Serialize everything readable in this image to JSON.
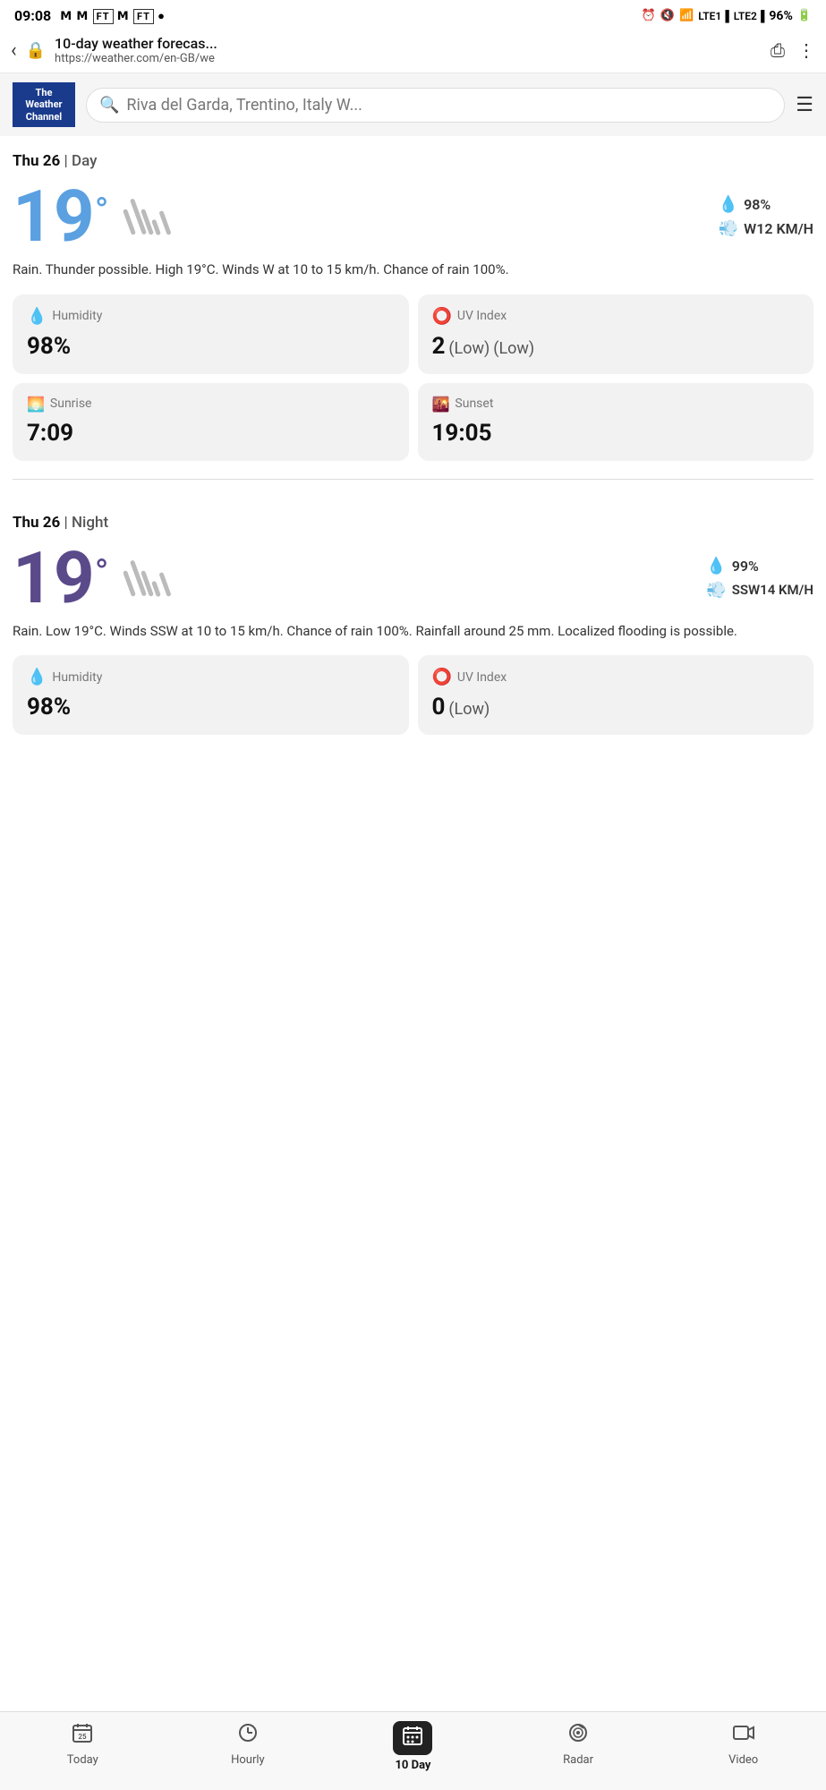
{
  "statusBar": {
    "time": "09:08",
    "leftIcons": "M M FT M FT •",
    "battery": "96%"
  },
  "browserBar": {
    "title": "10-day weather forecas...",
    "url": "https://weather.com/en-GB/we"
  },
  "header": {
    "logoLine1": "The",
    "logoLine2": "Weather",
    "logoLine3": "Channel",
    "searchPlaceholder": "Riva del Garda, Trentino, Italy W..."
  },
  "daySection": {
    "label": "Thu 26",
    "period": "Day",
    "temp": "19",
    "degree": "°",
    "rainPercent": "98%",
    "windSpeed": "W12 KM/H",
    "description": "Rain. Thunder possible. High 19°C. Winds W at 10 to 15 km/h. Chance of rain 100%.",
    "humidity": {
      "label": "Humidity",
      "value": "98%"
    },
    "uvIndex": {
      "label": "UV Index",
      "value": "2",
      "subValue": "(Low)"
    },
    "sunrise": {
      "label": "Sunrise",
      "value": "7:09"
    },
    "sunset": {
      "label": "Sunset",
      "value": "19:05"
    }
  },
  "nightSection": {
    "label": "Thu 26",
    "period": "Night",
    "temp": "19",
    "degree": "°",
    "rainPercent": "99%",
    "windSpeed": "SSW14 KM/H",
    "description": "Rain. Low 19°C. Winds SSW at 10 to 15 km/h. Chance of rain 100%. Rainfall around 25 mm. Localized flooding is possible.",
    "humidity": {
      "label": "Humidity",
      "value": "98%"
    },
    "uvIndex": {
      "label": "UV Index",
      "value": "0",
      "subValue": "(Low)"
    }
  },
  "bottomNav": {
    "today": "Today",
    "hourly": "Hourly",
    "tenDay": "10 Day",
    "radar": "Radar",
    "video": "Video"
  }
}
